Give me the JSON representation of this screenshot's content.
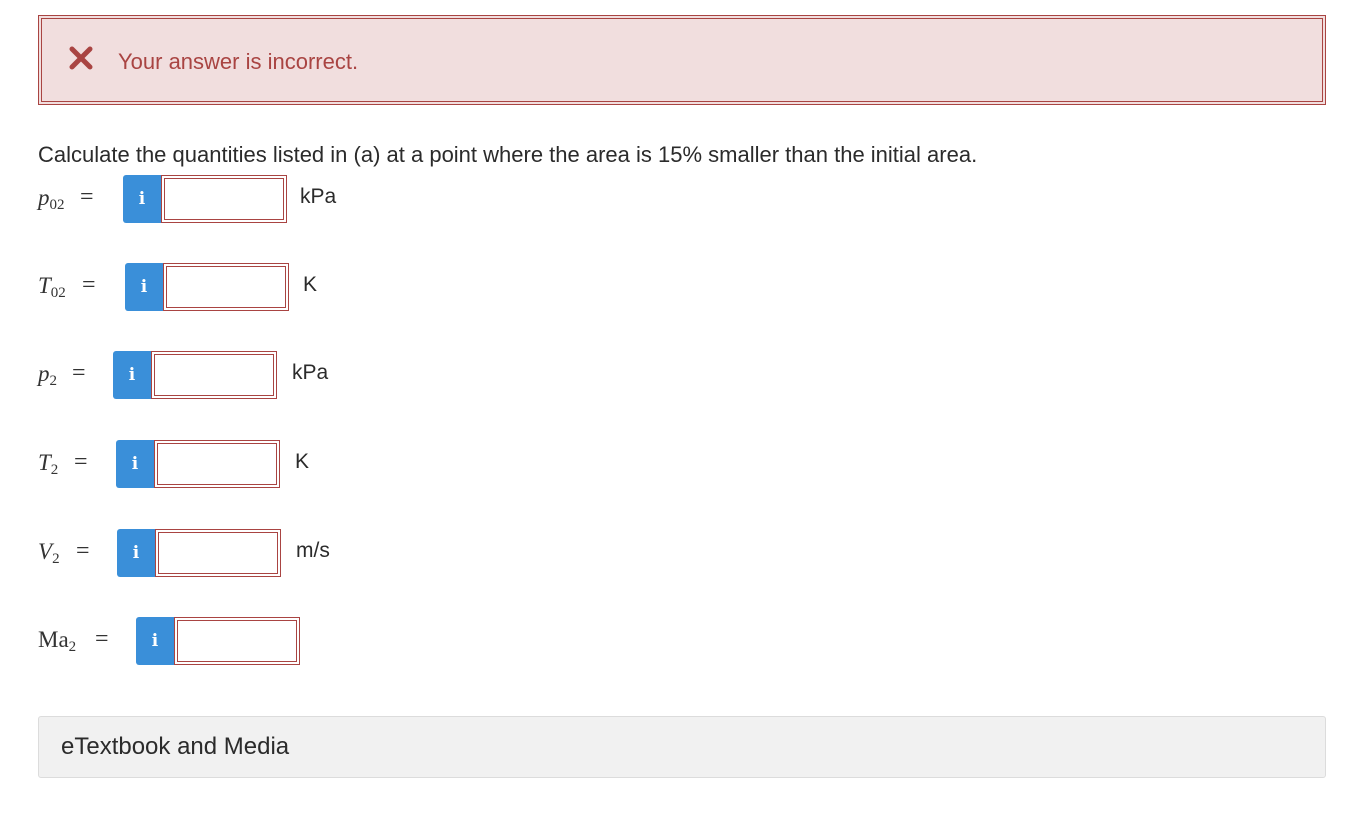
{
  "alert": {
    "icon": "close-x-icon",
    "text": "Your answer is incorrect.",
    "color": "#a94442",
    "background": "#f1dede"
  },
  "question": {
    "text": "Calculate the quantities listed in (a) at a point where the area is 15% smaller than the initial area."
  },
  "fields": [
    {
      "symbol": "p",
      "subscript": "02",
      "equals": "=",
      "info_icon": "info-icon",
      "info_label": "i",
      "value": "",
      "unit": "kPa"
    },
    {
      "symbol": "T",
      "subscript": "02",
      "equals": "=",
      "info_icon": "info-icon",
      "info_label": "i",
      "value": "",
      "unit": "K"
    },
    {
      "symbol": "p",
      "subscript": "2",
      "equals": "=",
      "info_icon": "info-icon",
      "info_label": "i",
      "value": "",
      "unit": "kPa"
    },
    {
      "symbol": "T",
      "subscript": "2",
      "equals": "=",
      "info_icon": "info-icon",
      "info_label": "i",
      "value": "",
      "unit": "K"
    },
    {
      "symbol": "V",
      "subscript": "2",
      "equals": "=",
      "info_icon": "info-icon",
      "info_label": "i",
      "value": "",
      "unit": "m/s"
    },
    {
      "symbol": "Ma",
      "subscript": "2",
      "equals": "=",
      "info_icon": "info-icon",
      "info_label": "i",
      "value": "",
      "unit": ""
    }
  ],
  "colors": {
    "info_button": "#3a8fd9",
    "error_border": "#a94442"
  },
  "etextbook": {
    "label": "eTextbook and Media"
  }
}
